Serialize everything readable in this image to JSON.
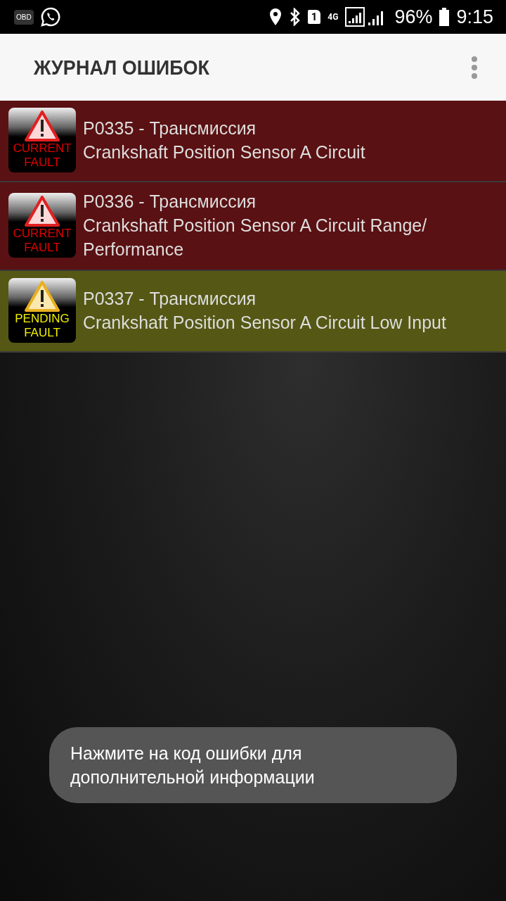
{
  "status_bar": {
    "app_badge": "OBD",
    "sim": "1",
    "network": "4G",
    "battery": "96%",
    "time": "9:15"
  },
  "app_bar": {
    "title": "ЖУРНАЛ ОШИБОК"
  },
  "faults": [
    {
      "kind": "current",
      "badge": [
        "CURRENT",
        "FAULT"
      ],
      "code": "P0335 - Трансмиссия",
      "description": "Crankshaft Position Sensor A Circuit"
    },
    {
      "kind": "current",
      "badge": [
        "CURRENT",
        "FAULT"
      ],
      "code": "P0336 - Трансмиссия",
      "description": "Crankshaft Position Sensor A Circuit Range/ Performance"
    },
    {
      "kind": "pending",
      "badge": [
        "PENDING",
        "FAULT"
      ],
      "code": "P0337 - Трансмиссия",
      "description": "Crankshaft Position Sensor A Circuit Low Input"
    }
  ],
  "toast": "Нажмите на код ошибки для дополнительной информации"
}
